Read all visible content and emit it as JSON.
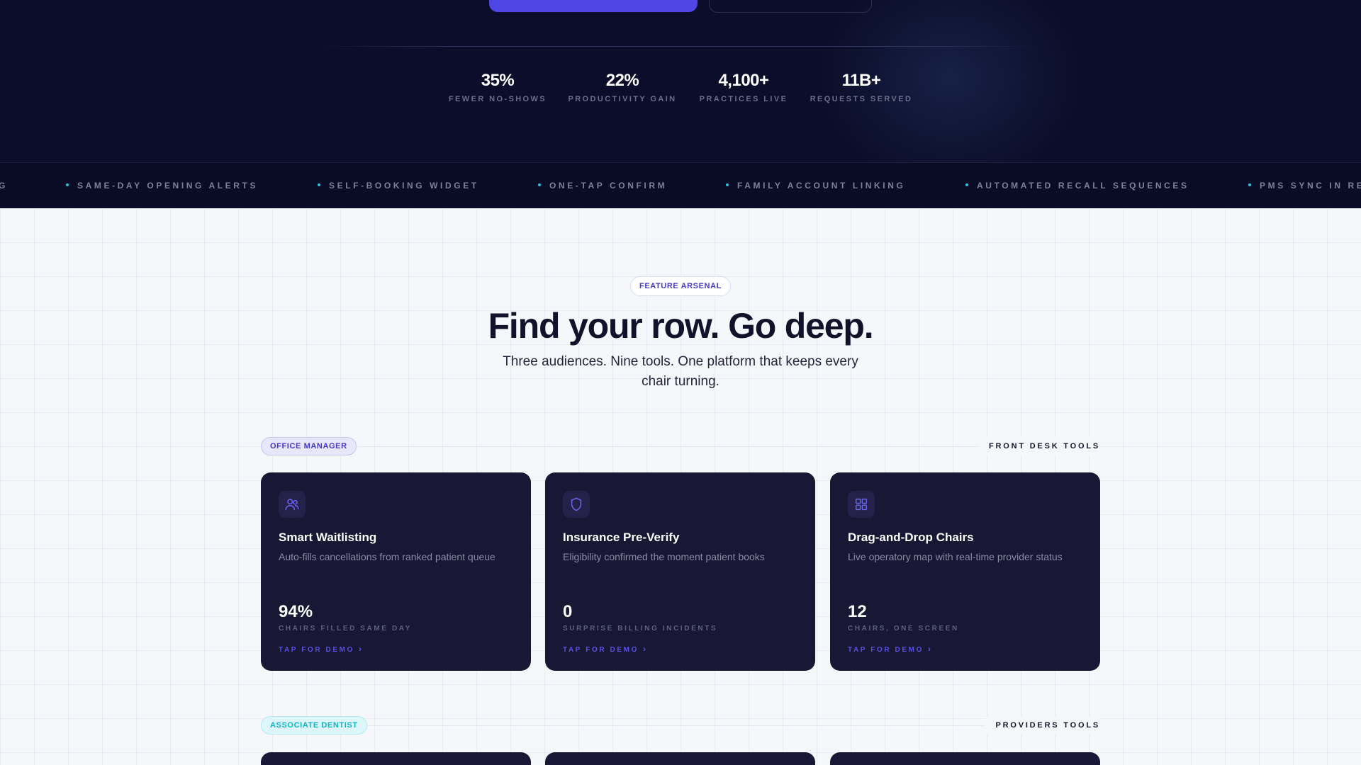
{
  "hero": {
    "stats": [
      {
        "value": "35%",
        "label": "FEWER NO-SHOWS"
      },
      {
        "value": "22%",
        "label": "PRODUCTIVITY GAIN"
      },
      {
        "value": "4,100+",
        "label": "PRACTICES LIVE"
      },
      {
        "value": "11B+",
        "label": "REQUESTS SERVED"
      }
    ]
  },
  "ticker": {
    "items": [
      "G",
      "SAME-DAY OPENING ALERTS",
      "SELF-BOOKING WIDGET",
      "ONE-TAP CONFIRM",
      "FAMILY ACCOUNT LINKING",
      "AUTOMATED RECALL SEQUENCES",
      "PMS SYNC IN RE"
    ],
    "dot_color": "#22c5dc"
  },
  "features": {
    "eyebrow": "FEATURE ARSENAL",
    "title": "Find your row. Go deep.",
    "subtitle": "Three audiences. Nine tools. One platform that keeps every chair turning.",
    "rows": [
      {
        "audience": "OFFICE MANAGER",
        "label": "FRONT DESK TOOLS",
        "cards": [
          {
            "icon": "users-icon",
            "title": "Smart Waitlisting",
            "desc": "Auto-fills cancellations from ranked patient queue",
            "metric": "94%",
            "metric_label": "CHAIRS FILLED SAME DAY",
            "cta": "TAP FOR DEMO"
          },
          {
            "icon": "shield-icon",
            "title": "Insurance Pre-Verify",
            "desc": "Eligibility confirmed the moment patient books",
            "metric": "0",
            "metric_label": "SURPRISE BILLING INCIDENTS",
            "cta": "TAP FOR DEMO"
          },
          {
            "icon": "grid-icon",
            "title": "Drag-and-Drop Chairs",
            "desc": "Live operatory map with real-time provider status",
            "metric": "12",
            "metric_label": "CHAIRS, ONE SCREEN",
            "cta": "TAP FOR DEMO"
          }
        ]
      },
      {
        "audience": "ASSOCIATE DENTIST",
        "label": "PROVIDERS TOOLS"
      }
    ]
  },
  "colors": {
    "hero_bg": "#0c0d2a",
    "accent": "#4f46e5",
    "card_bg": "#181734",
    "cyan": "#22c5dc"
  }
}
